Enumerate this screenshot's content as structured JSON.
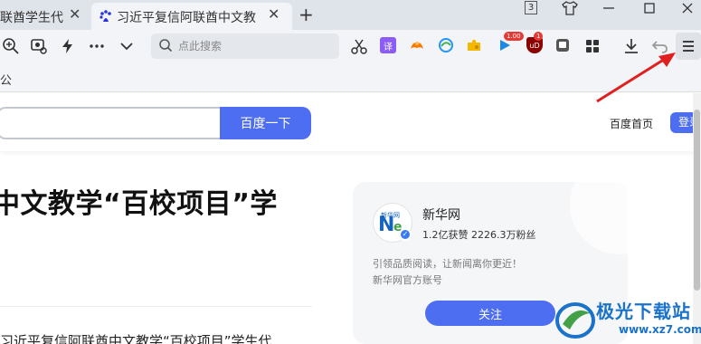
{
  "colors": {
    "accent": "#4e6ef2",
    "tabbar_bg": "#dfe3ea",
    "toolbar_bg": "#f2f4f7",
    "annotation_arrow": "#e02020",
    "watermark": "#1a72c9"
  },
  "tabs": [
    {
      "label": "联酋学生代",
      "active": false
    },
    {
      "label": "习近平复信阿联酋中文教",
      "active": true,
      "icon": "baidu-paw-icon"
    }
  ],
  "tabbar": {
    "new_tab": "+",
    "tab_count": "3",
    "close_glyph": "✕"
  },
  "toolbar": {
    "search_placeholder": "点此搜索",
    "translate_label": "译",
    "ext_badge_1": "1.00",
    "ext_badge_2": "1",
    "ublock_label": "uD",
    "icons": [
      "zoom-icon",
      "screenshot-icon",
      "lightning-icon",
      "more-icon",
      "chevron-down-icon",
      "scissors-icon",
      "translate-icon",
      "game-icon",
      "edge-icon",
      "puzzle-icon",
      "play-icon",
      "ublock-icon",
      "pocket-icon",
      "apps-icon",
      "download-icon",
      "undo-icon",
      "menu-icon"
    ]
  },
  "bookmarks": {
    "item": "公"
  },
  "header": {
    "search_button": "百度一下",
    "home_link": "百度首页",
    "login": "登录"
  },
  "article": {
    "title": "中文教学“百校项目”学",
    "body": "习近平复信阿联酋中文教学“百校项目”学生代"
  },
  "author": {
    "name": "新华网",
    "stats": "1.2亿获赞 2226.3万粉丝",
    "description": "引领品质阅读，让新闻离你更近！",
    "official": "新华网官方账号",
    "follow": "关注",
    "avatar_text": "新华网"
  },
  "watermark": {
    "title": "极光下载站",
    "url": "www.xz7.com"
  }
}
